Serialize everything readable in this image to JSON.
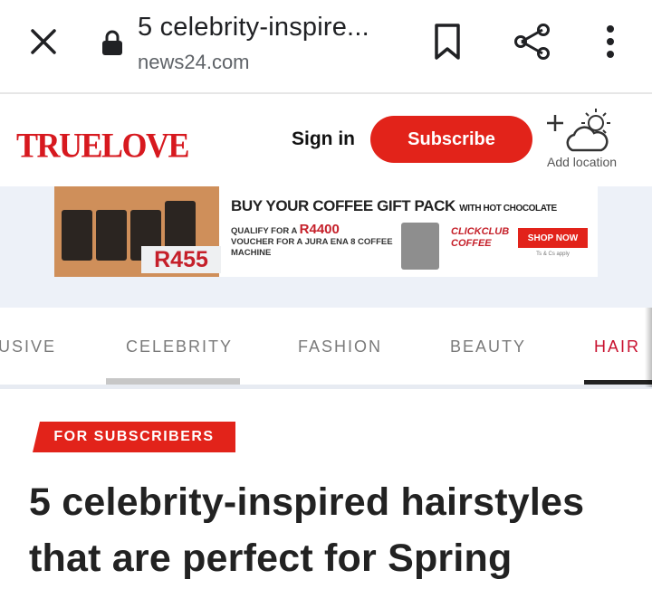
{
  "browser": {
    "page_title": "5 celebrity-inspire...",
    "url": "news24.com",
    "icons": [
      "close-icon",
      "lock-icon",
      "bookmark-icon",
      "share-icon",
      "more-vert-icon"
    ]
  },
  "header": {
    "logo": "TRUELOVE",
    "sign_in": "Sign in",
    "subscribe": "Subscribe",
    "add_location": "Add location",
    "brand_color": "#e2231a"
  },
  "ad": {
    "headline": "BUY YOUR COFFEE GIFT PACK",
    "headline_small": "WITH HOT CHOCOLATE",
    "qualify_prefix": "QUALIFY FOR A",
    "qualify_amount": "R4400",
    "qualify_rest": "VOUCHER FOR A JURA ENA 8 COFFEE MACHINE",
    "price": "R455",
    "club": "CLICKCLUB COFFEE",
    "shop_now": "SHOP NOW",
    "terms": "Ts & Cs apply"
  },
  "nav": {
    "items": [
      {
        "label": "USIVE"
      },
      {
        "label": "CELEBRITY"
      },
      {
        "label": "FASHION"
      },
      {
        "label": "BEAUTY"
      },
      {
        "label": "HAIR"
      }
    ]
  },
  "article": {
    "badge": "FOR SUBSCRIBERS",
    "title": "5 celebrity-inspired hairstyles that are perfect for Spring"
  }
}
